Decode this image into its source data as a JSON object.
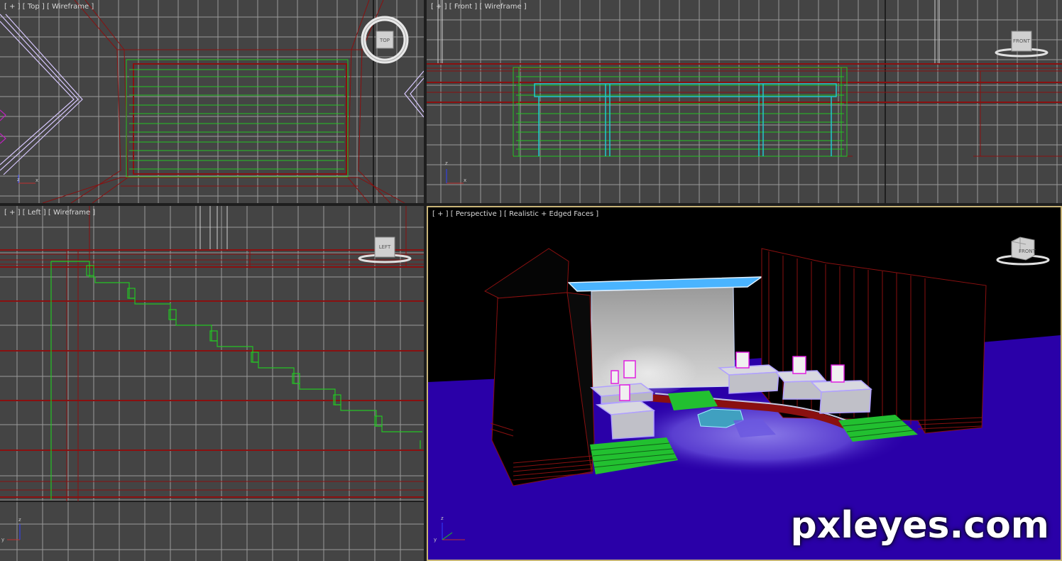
{
  "viewports": {
    "top": {
      "label_plus": "[ + ]",
      "label_view": "[ Top ]",
      "label_mode": "[ Wireframe ]",
      "cube_label": "TOP"
    },
    "front": {
      "label_plus": "[ + ]",
      "label_view": "[ Front ]",
      "label_mode": "[ Wireframe ]",
      "cube_label": "FRONT"
    },
    "left": {
      "label_plus": "[ + ]",
      "label_view": "[ Left ]",
      "label_mode": "[ Wireframe ]",
      "cube_label": "LEFT"
    },
    "perspective": {
      "label_plus": "[ + ]",
      "label_view": "[ Perspective ]",
      "label_mode": "[ Realistic + Edged Faces ]",
      "cube_label": "FRONT"
    }
  },
  "watermark": "pxleyes.com",
  "colors": {
    "viewport_bg": "#444444",
    "grid": "#9a9a9a",
    "wire_red": "#8a1010",
    "wire_green": "#24c424",
    "wire_cyan": "#20c8d0",
    "floor_blue": "#2a00a8",
    "active_border": "#c8b478"
  }
}
